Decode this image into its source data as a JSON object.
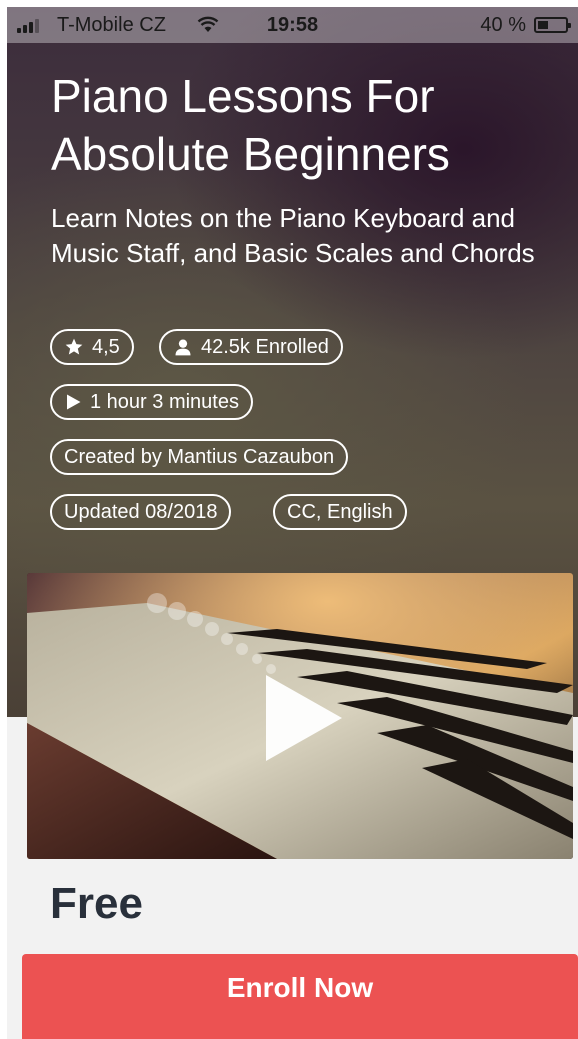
{
  "status_bar": {
    "carrier": "T-Mobile CZ",
    "time": "19:58",
    "battery_percent_text": "40 %",
    "battery_level": 0.4
  },
  "course": {
    "title": "Piano Lessons For Absolute Beginners",
    "subtitle": "Learn Notes on the Piano Keyboard and Music Staff, and Basic Scales and Chords",
    "rating": "4,5",
    "enrolled": "42.5k Enrolled",
    "duration": "1 hour 3 minutes",
    "created_by": "Created by Mantius Cazaubon",
    "updated": "Updated 08/2018",
    "captions": "CC, English"
  },
  "pricing": {
    "price": "Free",
    "enroll_label": "Enroll Now"
  },
  "icons": {
    "rating": "star-icon",
    "enrolled": "person-icon",
    "duration": "play-icon",
    "video": "play-button-icon"
  },
  "colors": {
    "accent": "#ec5252",
    "price_text": "#29303b",
    "page_background": "#f2f2f2"
  }
}
